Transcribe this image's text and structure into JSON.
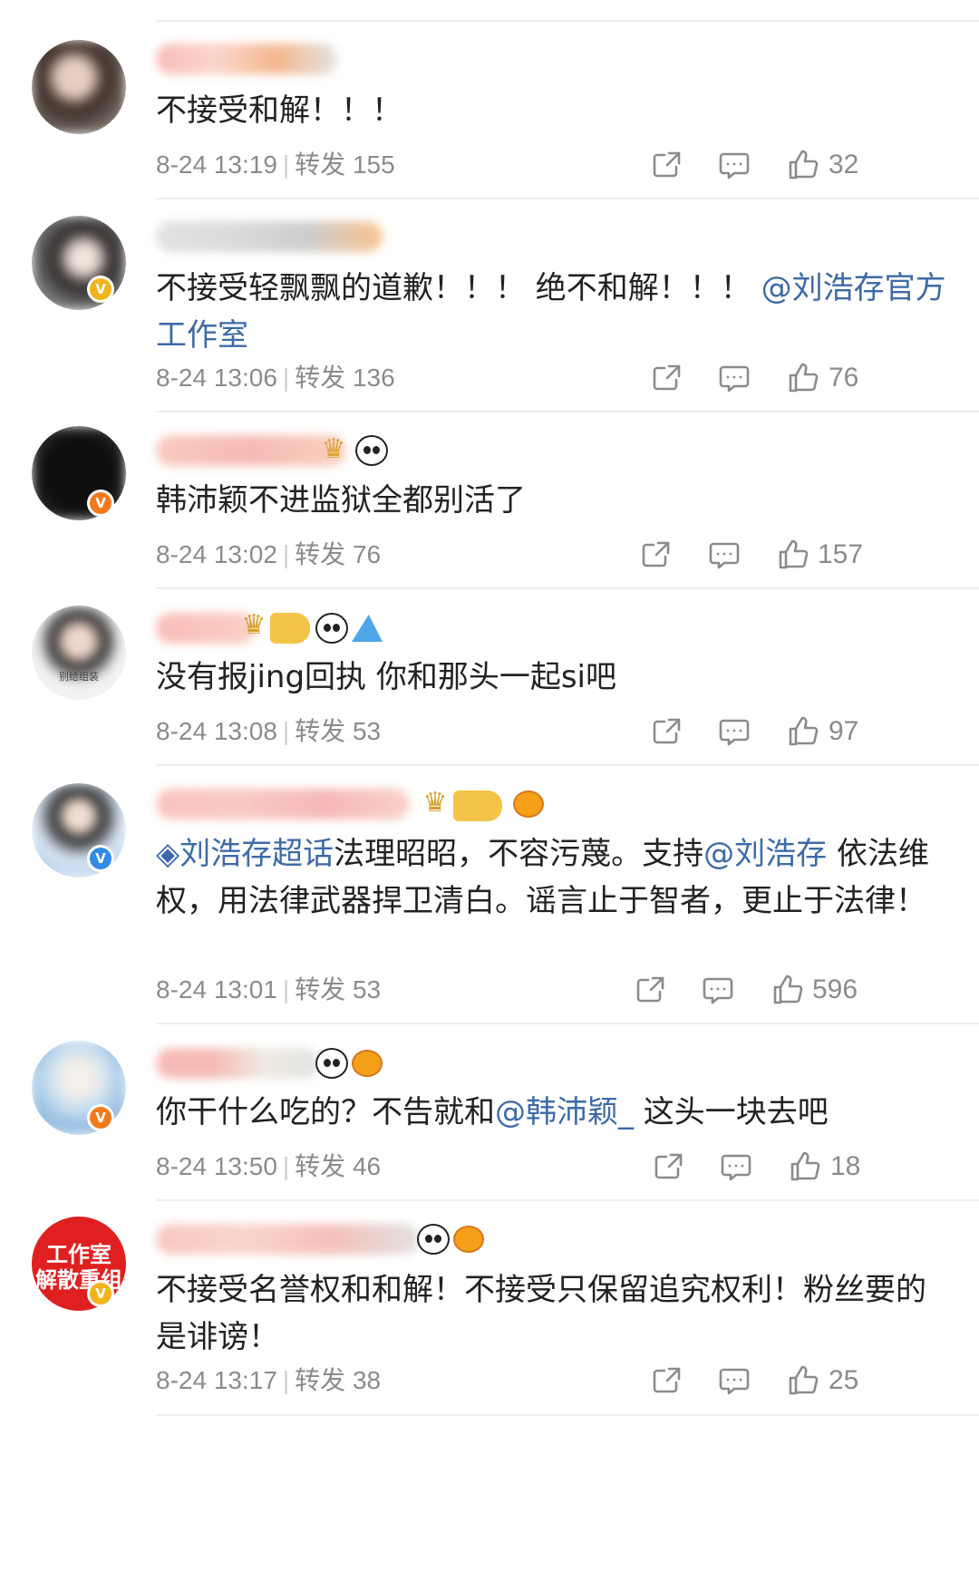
{
  "comments": [
    {
      "text": "不接受和解！！！",
      "time": "8-24 13:19",
      "repost_label": "转发",
      "repost_count": "155",
      "likes": "32"
    },
    {
      "text_parts": [
        "不接受轻飘飘的道歉！！！ 绝不和解！！！ ",
        "@刘浩存官方工作室"
      ],
      "time": "8-24 13:06",
      "repost_label": "转发",
      "repost_count": "136",
      "likes": "76"
    },
    {
      "text": "韩沛颖不进监狱全都别活了",
      "time": "8-24 13:02",
      "repost_label": "转发",
      "repost_count": "76",
      "likes": "157"
    },
    {
      "text": "没有报jing回执 你和那头一起si吧",
      "avatar_caption": "别给组装",
      "time": "8-24 13:08",
      "repost_label": "转发",
      "repost_count": "53",
      "likes": "97"
    },
    {
      "topic": "刘浩存超话",
      "text_a": "法理昭昭，不容污蔑。支持",
      "mention": "@刘浩存",
      "text_b": " 依法维权，用法律武器捍卫清白。谣言止于智者，更止于法律！",
      "time": "8-24 13:01",
      "repost_label": "转发",
      "repost_count": "53",
      "likes": "596"
    },
    {
      "text_a": "你干什么吃的？不告就和",
      "mention": "@韩沛颖_",
      "text_b": " 这头一块去吧",
      "time": "8-24 13:50",
      "repost_label": "转发",
      "repost_count": "46",
      "likes": "18"
    },
    {
      "text": "不接受名誉权和和解！不接受只保留追究权利！粉丝要的是诽谤！",
      "avatar_caption": "工作室 解散重组",
      "time": "8-24 13:17",
      "repost_label": "转发",
      "repost_count": "38",
      "likes": "25"
    }
  ],
  "icons": {
    "share": "share-icon",
    "comment": "comment-icon",
    "like": "thumbs-up-icon",
    "verified": "verified-v-icon"
  },
  "colors": {
    "mention": "#3d6aa8",
    "meta": "#8b8b8b",
    "verified_gold": "#f2b31c",
    "verified_orange": "#f27a1c",
    "verified_blue": "#2f8be6"
  }
}
